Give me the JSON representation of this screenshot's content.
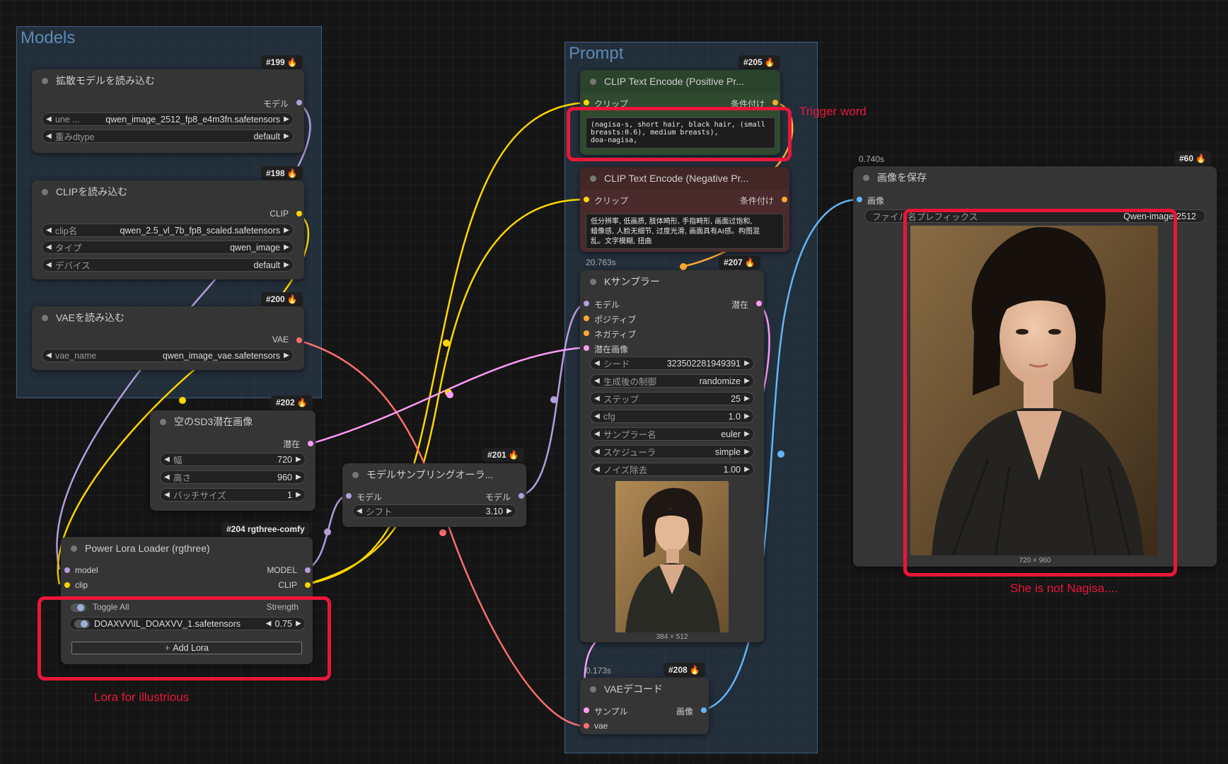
{
  "groups": {
    "models": "Models",
    "prompt": "Prompt"
  },
  "nodes": {
    "n199": {
      "id": "#199",
      "title": "拡散モデルを読み込む",
      "output": "モデル",
      "widgets": [
        {
          "name": "une ...",
          "value": "qwen_image_2512_fp8_e4m3fn.safetensors"
        },
        {
          "name": "重みdtype",
          "value": "default"
        }
      ]
    },
    "n198": {
      "id": "#198",
      "title": "CLIPを読み込む",
      "output": "CLIP",
      "widgets": [
        {
          "name": "clip名",
          "value": "qwen_2.5_vl_7b_fp8_scaled.safetensors"
        },
        {
          "name": "タイプ",
          "value": "qwen_image"
        },
        {
          "name": "デバイス",
          "value": "default"
        }
      ]
    },
    "n200": {
      "id": "#200",
      "title": "VAEを読み込む",
      "output": "VAE",
      "widgets": [
        {
          "name": "vae_name",
          "value": "qwen_image_vae.safetensors"
        }
      ]
    },
    "n202": {
      "id": "#202",
      "title": "空のSD3潜在画像",
      "output": "潜在",
      "widgets": [
        {
          "name": "幅",
          "value": "720"
        },
        {
          "name": "高さ",
          "value": "960"
        },
        {
          "name": "バッチサイズ",
          "value": "1"
        }
      ]
    },
    "n204": {
      "id": "#204 rgthree-comfy",
      "title": "Power Lora Loader (rgthree)",
      "inputs": [
        "model",
        "clip"
      ],
      "outputs": [
        "MODEL",
        "CLIP"
      ],
      "toggle_all": "Toggle All",
      "strength_label": "Strength",
      "lora_name": "DOAXVV\\IL_DOAXVV_1.safetensors",
      "lora_strength": "0.75",
      "add_lora": "Add Lora"
    },
    "n201": {
      "id": "#201",
      "title": "モデルサンプリングオーラ...",
      "input": "モデル",
      "output": "モデル",
      "widgets": [
        {
          "name": "シフト",
          "value": "3.10"
        }
      ]
    },
    "n205": {
      "id": "#205",
      "title": "CLIP Text Encode (Positive Pr...",
      "input": "クリップ",
      "output": "条件付け",
      "text": "(nagisa-s, short hair, black hair, (small\nbreasts:0.6), medium breasts),\ndoa-nagisa,"
    },
    "n206": {
      "title": "CLIP Text Encode (Negative Pr...",
      "input": "クリップ",
      "output": "条件付け",
      "text": "低分辨率, 低画质, 肢体畸形, 手指畸形, 画面过饱和,\n蜡像感, 人脸无细节, 过度光滑, 画面具有AI感。构图混\n乱。文字模糊, 扭曲"
    },
    "n207": {
      "id": "#207",
      "time": "20.763s",
      "title": "Kサンプラー",
      "inputs": [
        "モデル",
        "ポジティブ",
        "ネガティブ",
        "潜在画像"
      ],
      "output": "潜在",
      "widgets": [
        {
          "name": "シード",
          "value": "323502281949391"
        },
        {
          "name": "生成後の制御",
          "value": "randomize"
        },
        {
          "name": "ステップ",
          "value": "25"
        },
        {
          "name": "cfg",
          "value": "1.0"
        },
        {
          "name": "サンプラー名",
          "value": "euler"
        },
        {
          "name": "スケジューラ",
          "value": "simple"
        },
        {
          "name": "ノイズ除去",
          "value": "1.00"
        }
      ],
      "preview_size": "384 × 512"
    },
    "n208": {
      "id": "#208",
      "time": "0.173s",
      "title": "VAEデコード",
      "inputs": [
        "サンプル",
        "vae"
      ],
      "output": "画像"
    },
    "n60": {
      "id": "#60",
      "time": "0.740s",
      "title": "画像を保存",
      "input": "画像",
      "widget_name": "ファイル名プレフィックス",
      "widget_value": "Qwen-image-2512",
      "image_size": "720 × 960"
    }
  },
  "annotations": {
    "trigger_word": "Trigger word",
    "lora_note": "Lora for illustrious",
    "nagisa_note": "She is not Nagisa...."
  },
  "colors": {
    "model_link": "#b39ddb",
    "clip_link": "#ffd500",
    "vae_link": "#ff6e6e",
    "latent_link": "#ff9cf9",
    "image_link": "#64b5f6",
    "conditioning": "#ffa931",
    "annotation_red": "#e8173a"
  }
}
